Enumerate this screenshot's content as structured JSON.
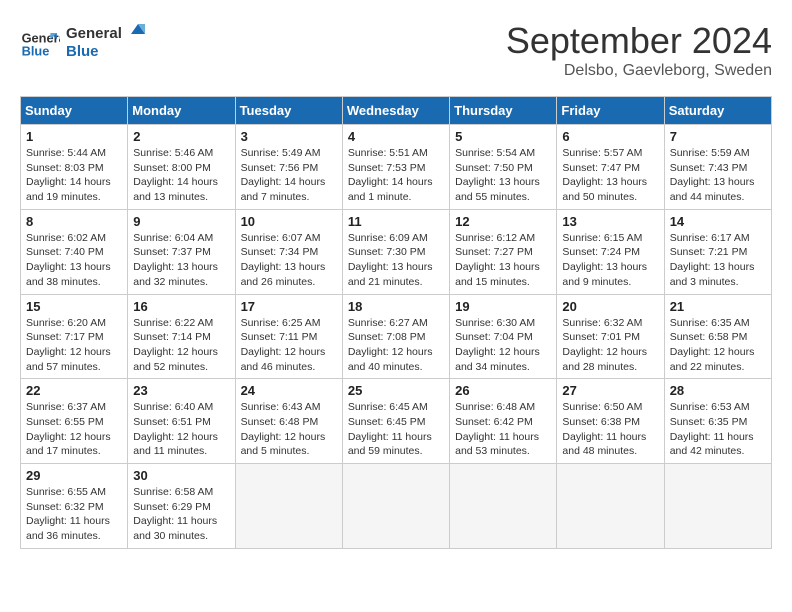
{
  "header": {
    "logo_line1": "General",
    "logo_line2": "Blue",
    "month": "September 2024",
    "location": "Delsbo, Gaevleborg, Sweden"
  },
  "days_of_week": [
    "Sunday",
    "Monday",
    "Tuesday",
    "Wednesday",
    "Thursday",
    "Friday",
    "Saturday"
  ],
  "weeks": [
    [
      {
        "day": 1,
        "info": "Sunrise: 5:44 AM\nSunset: 8:03 PM\nDaylight: 14 hours\nand 19 minutes."
      },
      {
        "day": 2,
        "info": "Sunrise: 5:46 AM\nSunset: 8:00 PM\nDaylight: 14 hours\nand 13 minutes."
      },
      {
        "day": 3,
        "info": "Sunrise: 5:49 AM\nSunset: 7:56 PM\nDaylight: 14 hours\nand 7 minutes."
      },
      {
        "day": 4,
        "info": "Sunrise: 5:51 AM\nSunset: 7:53 PM\nDaylight: 14 hours\nand 1 minute."
      },
      {
        "day": 5,
        "info": "Sunrise: 5:54 AM\nSunset: 7:50 PM\nDaylight: 13 hours\nand 55 minutes."
      },
      {
        "day": 6,
        "info": "Sunrise: 5:57 AM\nSunset: 7:47 PM\nDaylight: 13 hours\nand 50 minutes."
      },
      {
        "day": 7,
        "info": "Sunrise: 5:59 AM\nSunset: 7:43 PM\nDaylight: 13 hours\nand 44 minutes."
      }
    ],
    [
      {
        "day": 8,
        "info": "Sunrise: 6:02 AM\nSunset: 7:40 PM\nDaylight: 13 hours\nand 38 minutes."
      },
      {
        "day": 9,
        "info": "Sunrise: 6:04 AM\nSunset: 7:37 PM\nDaylight: 13 hours\nand 32 minutes."
      },
      {
        "day": 10,
        "info": "Sunrise: 6:07 AM\nSunset: 7:34 PM\nDaylight: 13 hours\nand 26 minutes."
      },
      {
        "day": 11,
        "info": "Sunrise: 6:09 AM\nSunset: 7:30 PM\nDaylight: 13 hours\nand 21 minutes."
      },
      {
        "day": 12,
        "info": "Sunrise: 6:12 AM\nSunset: 7:27 PM\nDaylight: 13 hours\nand 15 minutes."
      },
      {
        "day": 13,
        "info": "Sunrise: 6:15 AM\nSunset: 7:24 PM\nDaylight: 13 hours\nand 9 minutes."
      },
      {
        "day": 14,
        "info": "Sunrise: 6:17 AM\nSunset: 7:21 PM\nDaylight: 13 hours\nand 3 minutes."
      }
    ],
    [
      {
        "day": 15,
        "info": "Sunrise: 6:20 AM\nSunset: 7:17 PM\nDaylight: 12 hours\nand 57 minutes."
      },
      {
        "day": 16,
        "info": "Sunrise: 6:22 AM\nSunset: 7:14 PM\nDaylight: 12 hours\nand 52 minutes."
      },
      {
        "day": 17,
        "info": "Sunrise: 6:25 AM\nSunset: 7:11 PM\nDaylight: 12 hours\nand 46 minutes."
      },
      {
        "day": 18,
        "info": "Sunrise: 6:27 AM\nSunset: 7:08 PM\nDaylight: 12 hours\nand 40 minutes."
      },
      {
        "day": 19,
        "info": "Sunrise: 6:30 AM\nSunset: 7:04 PM\nDaylight: 12 hours\nand 34 minutes."
      },
      {
        "day": 20,
        "info": "Sunrise: 6:32 AM\nSunset: 7:01 PM\nDaylight: 12 hours\nand 28 minutes."
      },
      {
        "day": 21,
        "info": "Sunrise: 6:35 AM\nSunset: 6:58 PM\nDaylight: 12 hours\nand 22 minutes."
      }
    ],
    [
      {
        "day": 22,
        "info": "Sunrise: 6:37 AM\nSunset: 6:55 PM\nDaylight: 12 hours\nand 17 minutes."
      },
      {
        "day": 23,
        "info": "Sunrise: 6:40 AM\nSunset: 6:51 PM\nDaylight: 12 hours\nand 11 minutes."
      },
      {
        "day": 24,
        "info": "Sunrise: 6:43 AM\nSunset: 6:48 PM\nDaylight: 12 hours\nand 5 minutes."
      },
      {
        "day": 25,
        "info": "Sunrise: 6:45 AM\nSunset: 6:45 PM\nDaylight: 11 hours\nand 59 minutes."
      },
      {
        "day": 26,
        "info": "Sunrise: 6:48 AM\nSunset: 6:42 PM\nDaylight: 11 hours\nand 53 minutes."
      },
      {
        "day": 27,
        "info": "Sunrise: 6:50 AM\nSunset: 6:38 PM\nDaylight: 11 hours\nand 48 minutes."
      },
      {
        "day": 28,
        "info": "Sunrise: 6:53 AM\nSunset: 6:35 PM\nDaylight: 11 hours\nand 42 minutes."
      }
    ],
    [
      {
        "day": 29,
        "info": "Sunrise: 6:55 AM\nSunset: 6:32 PM\nDaylight: 11 hours\nand 36 minutes."
      },
      {
        "day": 30,
        "info": "Sunrise: 6:58 AM\nSunset: 6:29 PM\nDaylight: 11 hours\nand 30 minutes."
      },
      null,
      null,
      null,
      null,
      null
    ]
  ]
}
